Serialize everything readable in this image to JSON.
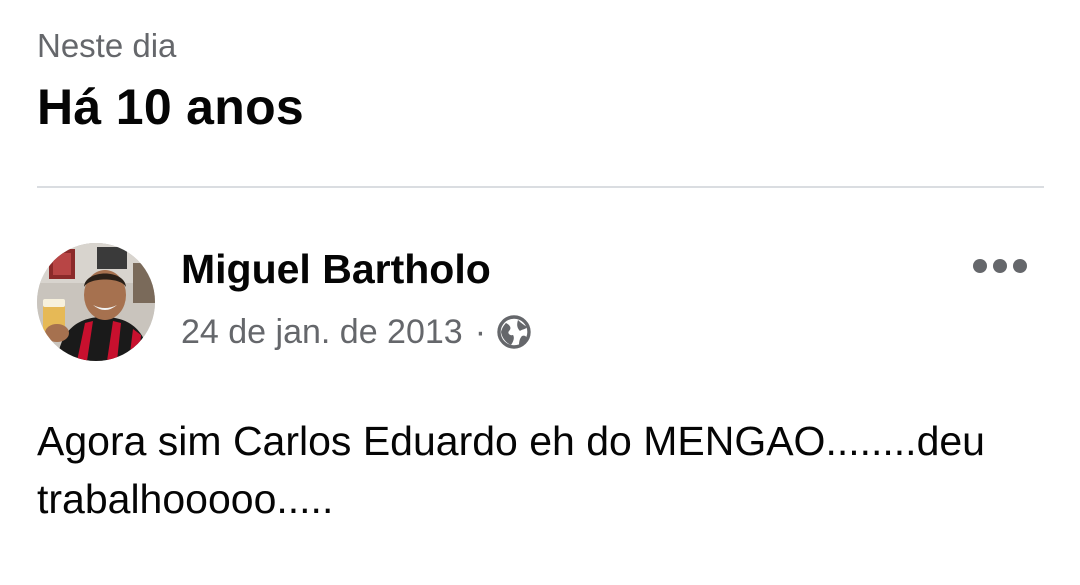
{
  "header": {
    "subtitle": "Neste dia",
    "title": "Há 10 anos"
  },
  "post": {
    "author": "Miguel Bartholo",
    "date": "24 de jan. de 2013",
    "separator": "·",
    "privacy_icon": "globe-icon",
    "more_icon": "more-horizontal-icon",
    "text": "Agora sim Carlos Eduardo eh do MENGAO........deu trabalhooooo....."
  },
  "colors": {
    "primary_text": "#050505",
    "secondary_text": "#65676b",
    "divider": "#dadde1",
    "team_red": "#c8102e"
  }
}
